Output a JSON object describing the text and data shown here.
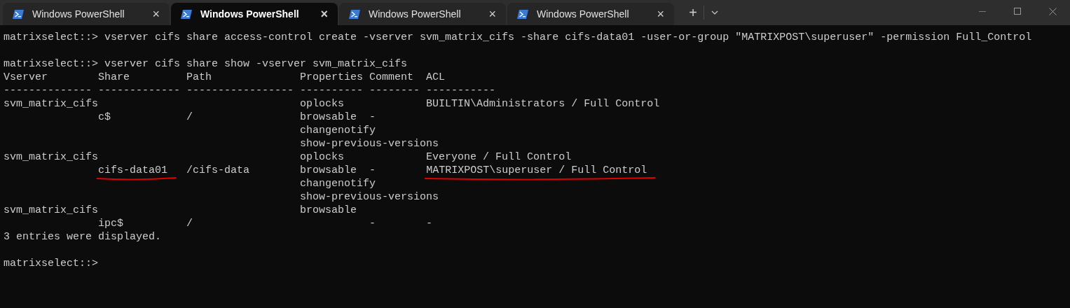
{
  "tabs": [
    {
      "title": "Windows PowerShell",
      "selected": false,
      "close": "×"
    },
    {
      "title": "Windows PowerShell",
      "selected": true,
      "close": "×"
    },
    {
      "title": "Windows PowerShell",
      "selected": false,
      "close": "×"
    },
    {
      "title": "Windows PowerShell",
      "selected": false,
      "close": "×"
    }
  ],
  "new_tab": "+",
  "terminal": {
    "lines": [
      {
        "kind": "text",
        "text": "matrixselect::> vserver cifs share access-control create -vserver svm_matrix_cifs -share cifs-data01 -user-or-group \"MATRIXPOST\\superuser\" -permission Full_Control"
      },
      {
        "kind": "blank"
      },
      {
        "kind": "text",
        "text": "matrixselect::> vserver cifs share show -vserver svm_matrix_cifs"
      },
      {
        "kind": "text",
        "text": "Vserver        Share         Path              Properties Comment  ACL"
      },
      {
        "kind": "text",
        "text": "-------------- ------------- ----------------- ---------- -------- -----------"
      },
      {
        "kind": "text",
        "text": "svm_matrix_cifs                                oplocks             BUILTIN\\Administrators / Full Control"
      },
      {
        "kind": "text",
        "text": "               c$            /                 browsable  -"
      },
      {
        "kind": "text",
        "text": "                                               changenotify"
      },
      {
        "kind": "text",
        "text": "                                               show-previous-versions"
      },
      {
        "kind": "text",
        "text": "svm_matrix_cifs                                oplocks             Everyone / Full Control"
      },
      {
        "kind": "segments",
        "segments": [
          {
            "text": "               cifs-data01",
            "marked": true
          },
          {
            "text": "   /cifs-data        browsable  -",
            "marked": false
          },
          {
            "text": "        MATRIXPOST\\superuser / Full Control",
            "marked": true
          }
        ]
      },
      {
        "kind": "text",
        "text": "                                               changenotify"
      },
      {
        "kind": "text",
        "text": "                                               show-previous-versions"
      },
      {
        "kind": "text",
        "text": "svm_matrix_cifs                                browsable"
      },
      {
        "kind": "text",
        "text": "               ipc$          /                            -        -"
      },
      {
        "kind": "text",
        "text": "3 entries were displayed."
      },
      {
        "kind": "blank"
      },
      {
        "kind": "text",
        "text": "matrixselect::> "
      }
    ]
  }
}
